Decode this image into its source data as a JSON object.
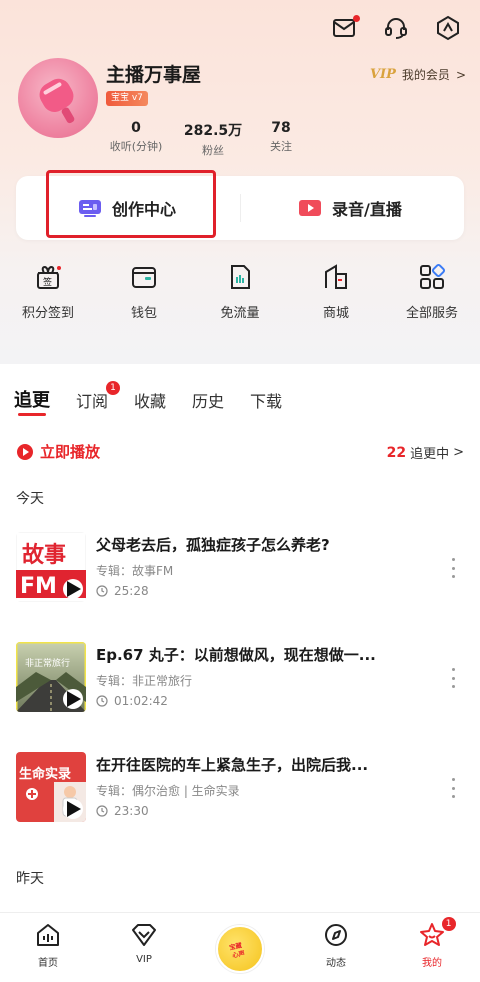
{
  "header": {
    "icons": [
      "mail-icon",
      "headset-icon",
      "settings-icon"
    ],
    "username": "主播万事屋",
    "level_badge": "宝宝 v7",
    "vip": {
      "logo": "VIP",
      "label": "我的会员",
      "chevron": ">"
    },
    "stats": [
      {
        "value": "0",
        "label": "收听(分钟)"
      },
      {
        "value": "282.5万",
        "label": "粉丝"
      },
      {
        "value": "78",
        "label": "关注"
      }
    ]
  },
  "creator_card": {
    "creation_center": "创作中心",
    "record_live": "录音/直播"
  },
  "quick_actions": [
    {
      "icon": "gift-icon",
      "label": "积分签到"
    },
    {
      "icon": "wallet-icon",
      "label": "钱包"
    },
    {
      "icon": "sim-card-icon",
      "label": "免流量"
    },
    {
      "icon": "shop-icon",
      "label": "商城"
    },
    {
      "icon": "grid-icon",
      "label": "全部服务"
    }
  ],
  "tabs": [
    {
      "label": "追更",
      "active": true
    },
    {
      "label": "订阅",
      "badge": "1"
    },
    {
      "label": "收藏"
    },
    {
      "label": "历史"
    },
    {
      "label": "下载"
    }
  ],
  "feed": {
    "play_now": "立即播放",
    "following_count": "22",
    "following_label": "追更中",
    "following_chevron": ">",
    "today": "今天",
    "yesterday": "昨天",
    "episodes": [
      {
        "title": "父母老去后，孤独症孩子怎么养老?",
        "album": "专辑：故事FM",
        "duration": "25:28",
        "thumb_text": "故事\nFM"
      },
      {
        "title": "Ep.67 丸子：以前想做风，现在想做一...",
        "album": "专辑：非正常旅行",
        "duration": "01:02:42",
        "thumb_text": "非正常旅行"
      },
      {
        "title": "在开往医院的车上紧急生子，出院后我...",
        "album": "专辑：偶尔治愈 | 生命实录",
        "duration": "23:30",
        "thumb_text": "生命实录"
      }
    ]
  },
  "bottom_nav": [
    {
      "icon": "home-icon",
      "label": "首页"
    },
    {
      "icon": "vip-icon",
      "label": "VIP"
    },
    {
      "icon": "center-logo-icon",
      "label": ""
    },
    {
      "icon": "compass-icon",
      "label": "动态"
    },
    {
      "icon": "star-house-icon",
      "label": "我的",
      "active": true,
      "badge": "1"
    }
  ],
  "colors": {
    "accent": "#e8262a",
    "vip_gold": "#d9a23d",
    "header_bg": "#fbe3da"
  }
}
